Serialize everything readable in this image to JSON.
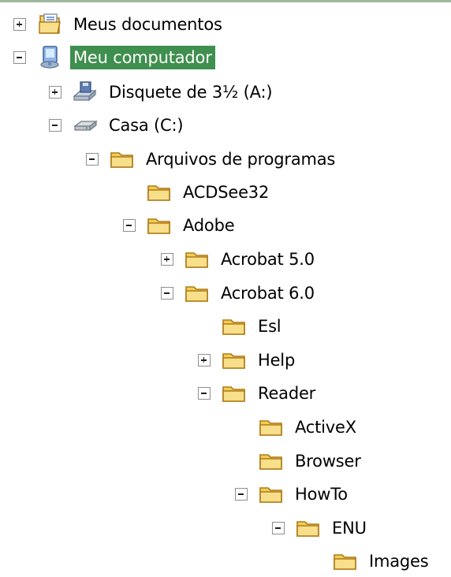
{
  "tree": {
    "items": [
      {
        "label": "Meus documentos",
        "icon": "my-documents-icon",
        "state": "collapsed",
        "selected": false
      },
      {
        "label": "Meu computador",
        "icon": "my-computer-icon",
        "state": "expanded",
        "selected": true
      },
      {
        "label": "Disquete de 3½ (A:)",
        "icon": "floppy-drive-icon",
        "state": "collapsed",
        "selected": false
      },
      {
        "label": "Casa (C:)",
        "icon": "hard-drive-icon",
        "state": "expanded",
        "selected": false
      },
      {
        "label": "Arquivos de programas",
        "icon": "folder-icon",
        "state": "expanded",
        "selected": false
      },
      {
        "label": "ACDSee32",
        "icon": "folder-icon",
        "state": "leaf",
        "selected": false
      },
      {
        "label": "Adobe",
        "icon": "folder-icon",
        "state": "expanded",
        "selected": false
      },
      {
        "label": "Acrobat 5.0",
        "icon": "folder-icon",
        "state": "collapsed",
        "selected": false
      },
      {
        "label": "Acrobat 6.0",
        "icon": "folder-icon",
        "state": "expanded",
        "selected": false
      },
      {
        "label": "Esl",
        "icon": "folder-icon",
        "state": "leaf",
        "selected": false
      },
      {
        "label": "Help",
        "icon": "folder-icon",
        "state": "collapsed",
        "selected": false
      },
      {
        "label": "Reader",
        "icon": "folder-icon",
        "state": "expanded",
        "selected": false
      },
      {
        "label": "ActiveX",
        "icon": "folder-icon",
        "state": "leaf",
        "selected": false
      },
      {
        "label": "Browser",
        "icon": "folder-icon",
        "state": "leaf",
        "selected": false
      },
      {
        "label": "HowTo",
        "icon": "folder-icon",
        "state": "expanded",
        "selected": false
      },
      {
        "label": "ENU",
        "icon": "folder-icon",
        "state": "expanded",
        "selected": false
      },
      {
        "label": "Images",
        "icon": "folder-icon",
        "state": "leaf",
        "selected": false
      }
    ]
  },
  "colors": {
    "selection_background": "#3f8f4e",
    "selection_text": "#ffffff",
    "folder_fill": "#f3d35d",
    "folder_outline": "#b07b17"
  }
}
